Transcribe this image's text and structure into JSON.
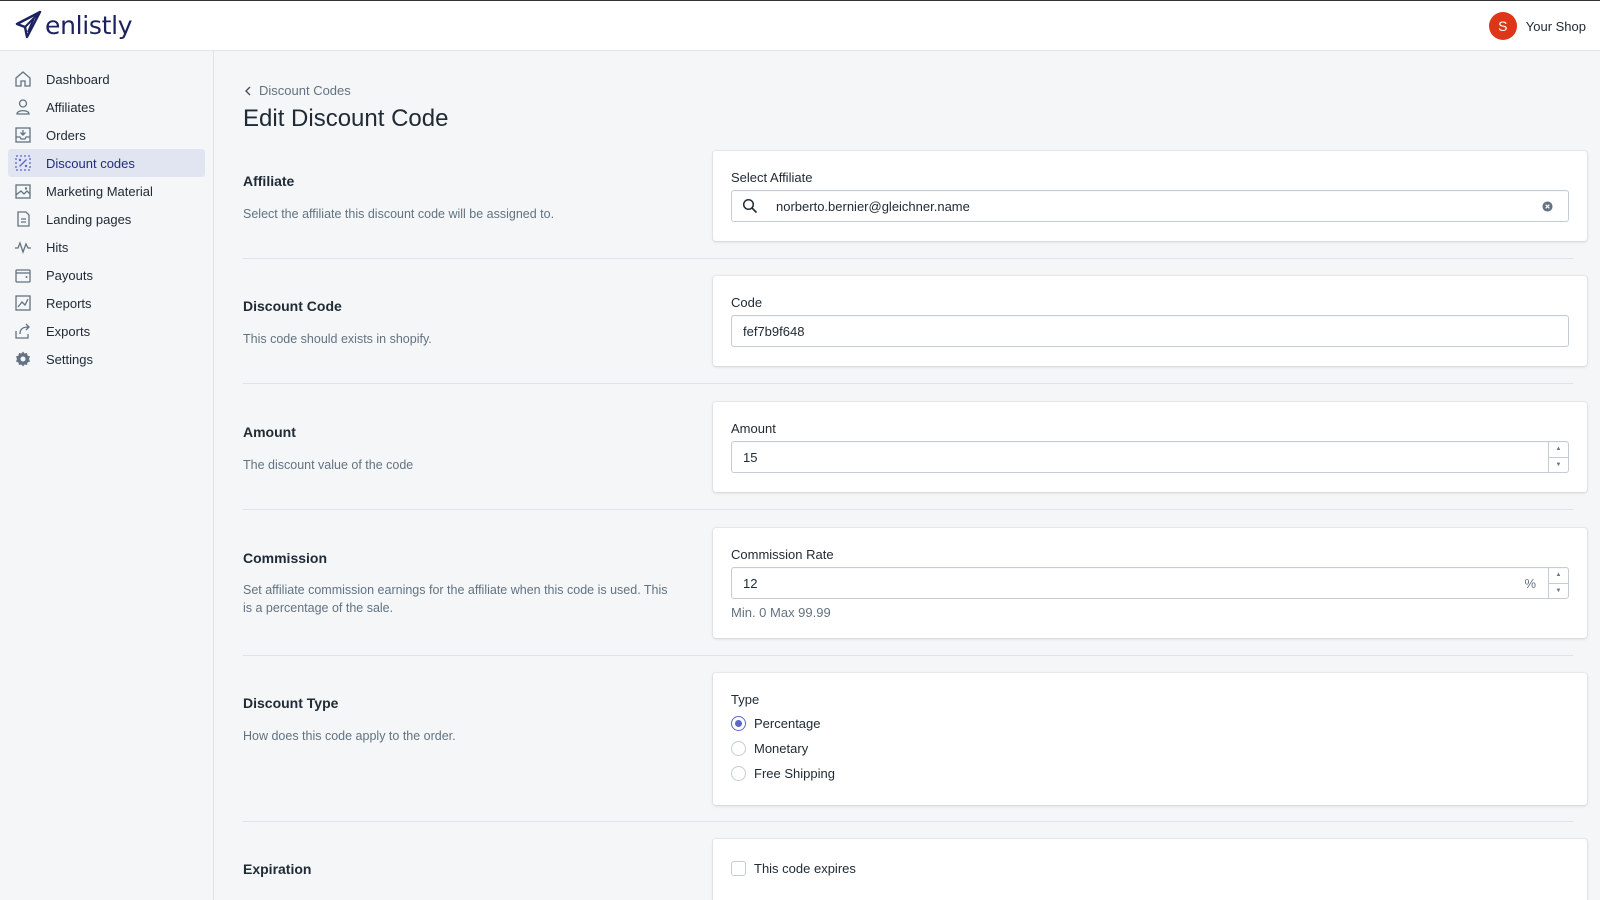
{
  "app": {
    "brand": "enlistly"
  },
  "header": {
    "shop_initial": "S",
    "shop_name": "Your Shop"
  },
  "sidebar": {
    "items": [
      {
        "label": "Dashboard",
        "icon": "home-icon"
      },
      {
        "label": "Affiliates",
        "icon": "person-icon"
      },
      {
        "label": "Orders",
        "icon": "inbox-icon"
      },
      {
        "label": "Discount codes",
        "icon": "discount-icon",
        "active": true
      },
      {
        "label": "Marketing Material",
        "icon": "image-icon"
      },
      {
        "label": "Landing pages",
        "icon": "page-icon"
      },
      {
        "label": "Hits",
        "icon": "pulse-icon"
      },
      {
        "label": "Payouts",
        "icon": "wallet-icon"
      },
      {
        "label": "Reports",
        "icon": "chart-icon"
      },
      {
        "label": "Exports",
        "icon": "export-icon"
      },
      {
        "label": "Settings",
        "icon": "gear-icon"
      }
    ]
  },
  "page": {
    "breadcrumb": "Discount Codes",
    "title": "Edit Discount Code"
  },
  "sections": {
    "affiliate": {
      "title": "Affiliate",
      "description": "Select the affiliate this discount code will be assigned to.",
      "field_label": "Select Affiliate",
      "value": "norberto.bernier@gleichner.name"
    },
    "code": {
      "title": "Discount Code",
      "description": "This code should exists in shopify.",
      "field_label": "Code",
      "value": "fef7b9f648"
    },
    "amount": {
      "title": "Amount",
      "description": "The discount value of the code",
      "field_label": "Amount",
      "value": "15"
    },
    "commission": {
      "title": "Commission",
      "description": "Set affiliate commission earnings for the affiliate when this code is used. This is a percentage of the sale.",
      "field_label": "Commission Rate",
      "value": "12",
      "suffix": "%",
      "help": "Min. 0 Max 99.99"
    },
    "type": {
      "title": "Discount Type",
      "description": "How does this code apply to the order.",
      "field_label": "Type",
      "options": [
        "Percentage",
        "Monetary",
        "Free Shipping"
      ],
      "selected": "Percentage"
    },
    "expiration": {
      "title": "Expiration",
      "checkbox_label": "This code expires"
    }
  },
  "colors": {
    "brand": "#1c2260",
    "accent": "#5c6ac4",
    "avatar": "#de3618",
    "active_nav": "#e1e5f2"
  }
}
